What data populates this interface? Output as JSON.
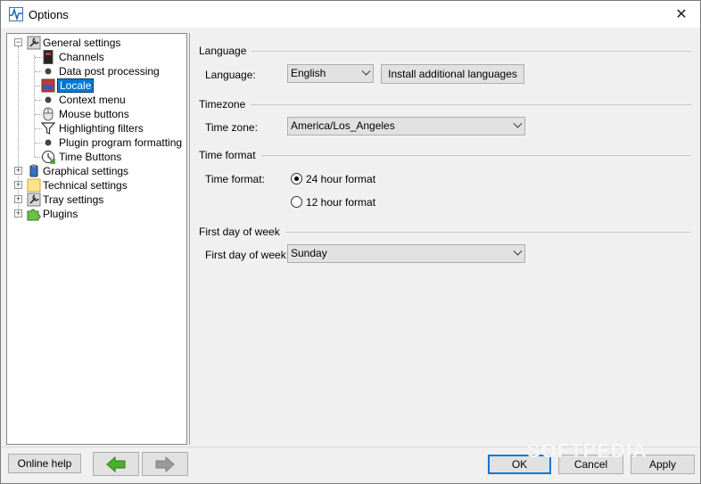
{
  "window": {
    "title": "Options",
    "close_glyph": "✕"
  },
  "tree": {
    "items": [
      {
        "label": "General settings",
        "icon": "wrench-icon"
      },
      {
        "label": "Channels",
        "icon": "channels-icon"
      },
      {
        "label": "Data post processing",
        "icon": "bullet-icon"
      },
      {
        "label": "Locale",
        "icon": "locale-icon"
      },
      {
        "label": "Context menu",
        "icon": "bullet-icon"
      },
      {
        "label": "Mouse buttons",
        "icon": "mouse-icon"
      },
      {
        "label": "Highlighting filters",
        "icon": "filter-icon"
      },
      {
        "label": "Plugin program formatting",
        "icon": "bullet-icon"
      },
      {
        "label": "Time Buttons",
        "icon": "clock-icon"
      },
      {
        "label": "Graphical settings",
        "icon": "paint-icon"
      },
      {
        "label": "Technical settings",
        "icon": "folder-icon"
      },
      {
        "label": "Tray settings",
        "icon": "wrench-icon"
      },
      {
        "label": "Plugins",
        "icon": "puzzle-icon"
      }
    ]
  },
  "language": {
    "section": "Language",
    "label": "Language:",
    "value": "English",
    "install_button": "Install additional languages"
  },
  "timezone": {
    "section": "Timezone",
    "label": "Time zone:",
    "value": "America/Los_Angeles"
  },
  "timeformat": {
    "section": "Time format",
    "label": "Time format:",
    "option24": "24 hour format",
    "option12": "12 hour format",
    "selected": "24 hour format"
  },
  "firstday": {
    "section": "First day of week",
    "label": "First day of week:",
    "value": "Sunday"
  },
  "footer": {
    "online_help": "Online help",
    "ok": "OK",
    "cancel": "Cancel",
    "apply": "Apply"
  },
  "watermark": "SOFTPEDIA",
  "colors": {
    "selection": "#0078d7",
    "nav_arrow": "#4caf2a"
  }
}
